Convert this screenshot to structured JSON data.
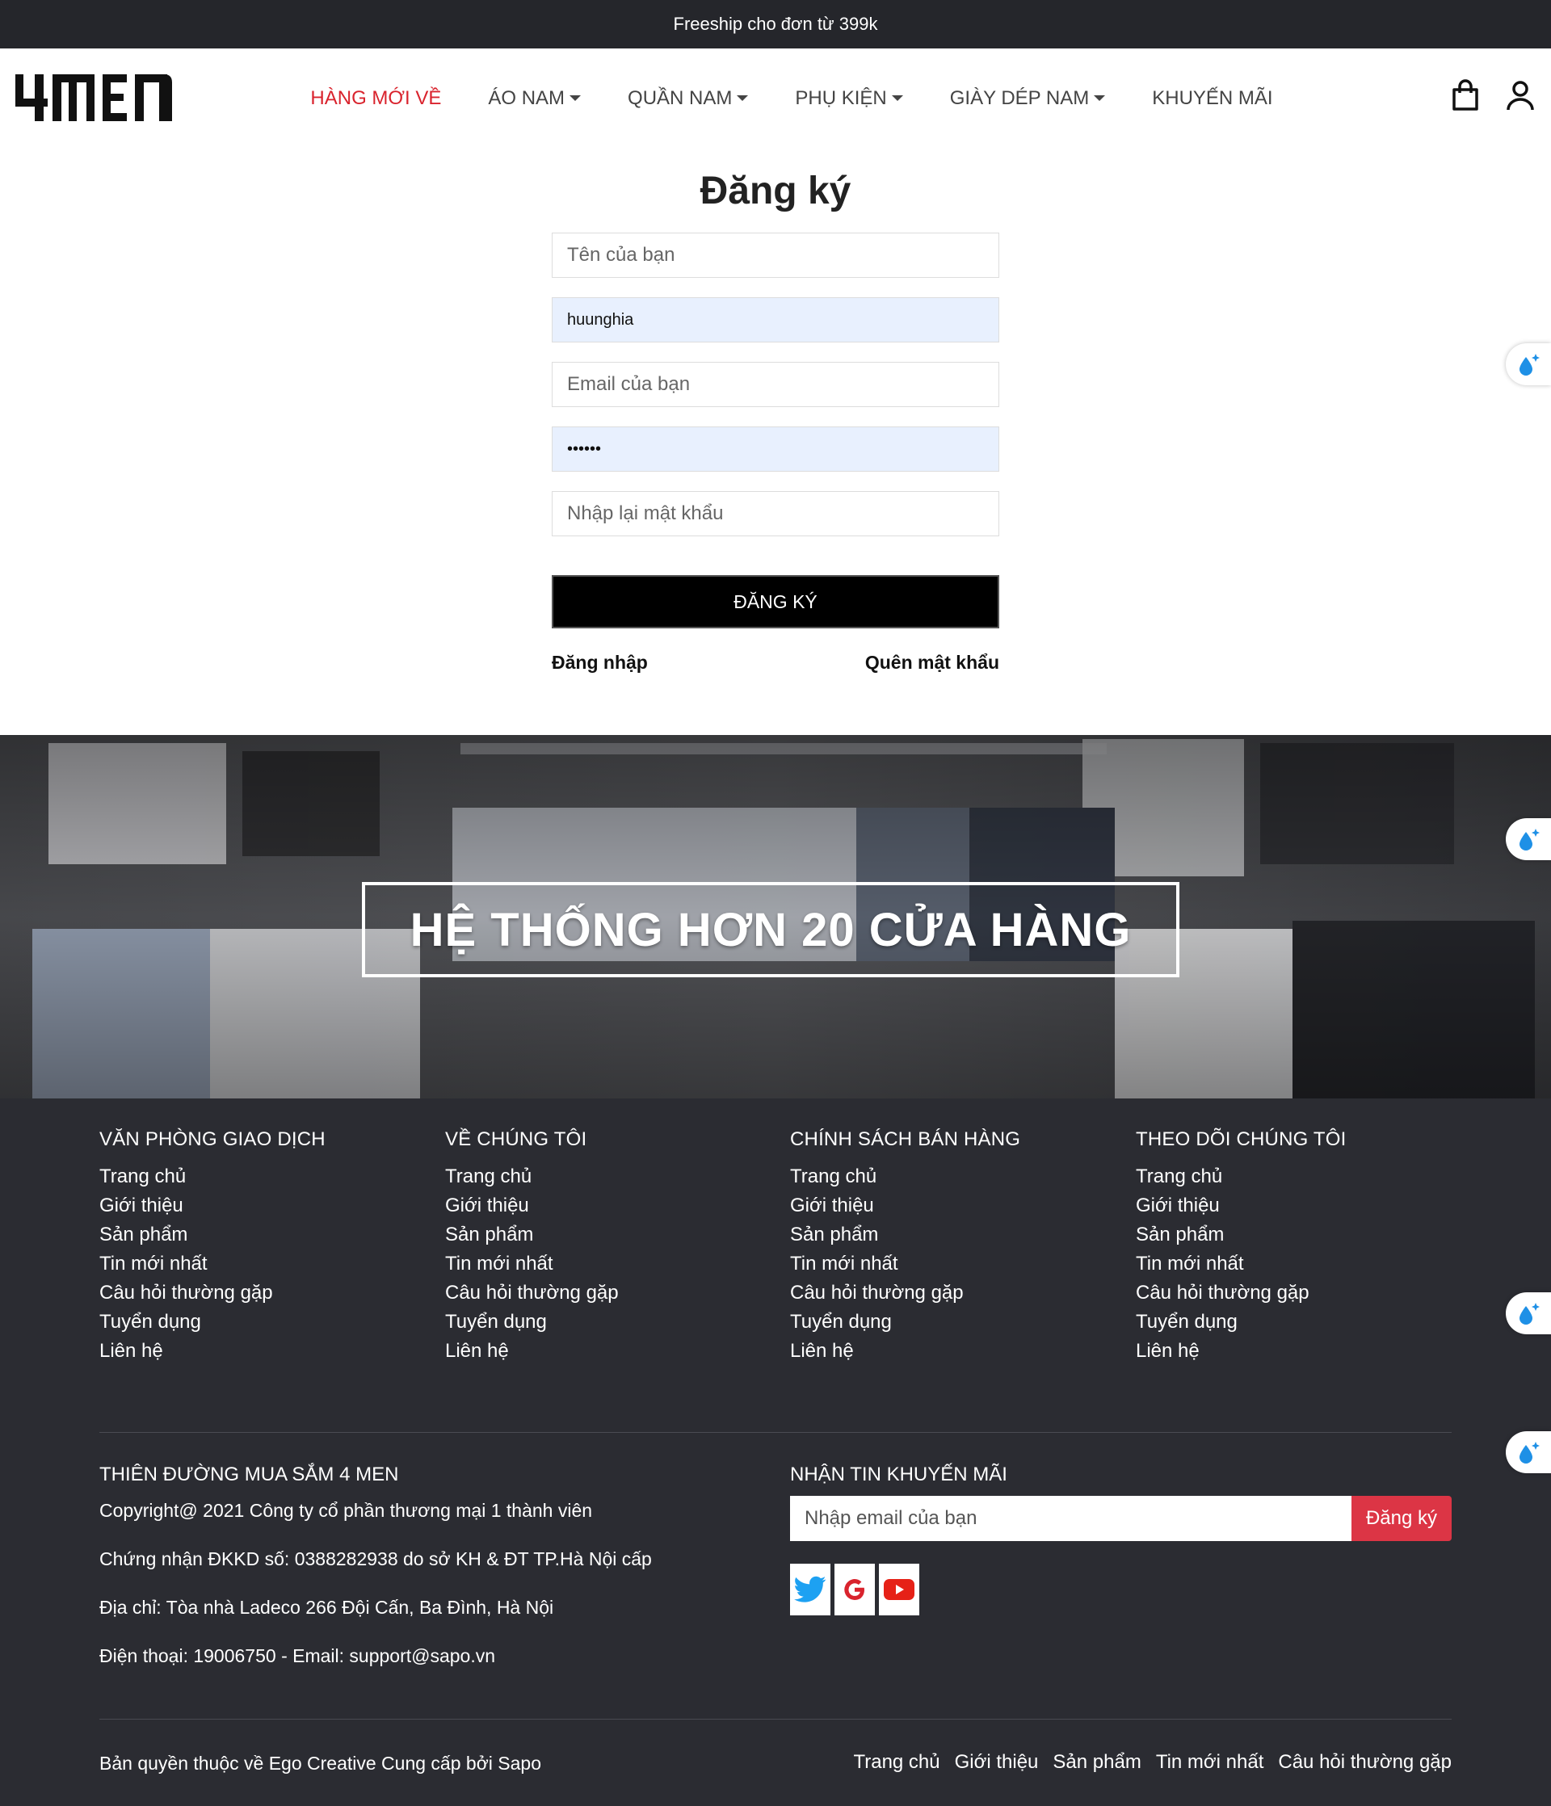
{
  "topbar": {
    "text": "Freeship cho đơn từ 399k"
  },
  "header": {
    "logo_text": "4MEN",
    "nav": [
      {
        "label": "HÀNG MỚI VỀ",
        "active": true,
        "dropdown": false
      },
      {
        "label": "ÁO NAM",
        "active": false,
        "dropdown": true
      },
      {
        "label": "QUẦN NAM",
        "active": false,
        "dropdown": true
      },
      {
        "label": "PHỤ KIỆN",
        "active": false,
        "dropdown": true
      },
      {
        "label": "GIÀY DÉP NAM",
        "active": false,
        "dropdown": true
      },
      {
        "label": "KHUYẾN MÃI",
        "active": false,
        "dropdown": false
      }
    ],
    "icons": [
      "cart-icon",
      "user-icon"
    ]
  },
  "register": {
    "title": "Đăng ký",
    "name_placeholder": "Tên của bạn",
    "username_value": "huunghia",
    "email_placeholder": "Email của bạn",
    "password_value": "••••••",
    "confirm_placeholder": "Nhập lại mật khẩu",
    "submit_label": "ĐĂNG KÝ",
    "login_link": "Đăng nhập",
    "forgot_link": "Quên mật khẩu"
  },
  "banner": {
    "text": "HỆ THỐNG HƠN 20 CỬA HÀNG"
  },
  "footer": {
    "columns": [
      {
        "title": "VĂN PHÒNG GIAO DỊCH",
        "links": [
          "Trang chủ",
          "Giới thiệu",
          "Sản phẩm",
          "Tin mới nhất",
          "Câu hỏi thường gặp",
          "Tuyển dụng",
          "Liên hệ"
        ]
      },
      {
        "title": "VỀ CHÚNG TÔI",
        "links": [
          "Trang chủ",
          "Giới thiệu",
          "Sản phẩm",
          "Tin mới nhất",
          "Câu hỏi thường gặp",
          "Tuyển dụng",
          "Liên hệ"
        ]
      },
      {
        "title": "CHÍNH SÁCH BÁN HÀNG",
        "links": [
          "Trang chủ",
          "Giới thiệu",
          "Sản phẩm",
          "Tin mới nhất",
          "Câu hỏi thường gặp",
          "Tuyển dụng",
          "Liên hệ"
        ]
      },
      {
        "title": "THEO DÕI CHÚNG TÔI",
        "links": [
          "Trang chủ",
          "Giới thiệu",
          "Sản phẩm",
          "Tin mới nhất",
          "Câu hỏi thường gặp",
          "Tuyển dụng",
          "Liên hệ"
        ]
      }
    ],
    "company_title": "THIÊN ĐƯỜNG MUA SẮM 4 MEN",
    "company_info": [
      "Copyright@ 2021 Công ty cổ phần thương mại 1 thành viên",
      "Chứng nhận ĐKKD số: 0388282938 do sở KH & ĐT TP.Hà Nội cấp",
      "Địa chỉ: Tòa nhà Ladeco 266 Đội Cấn, Ba Đình, Hà Nội",
      "Điện thoại: 19006750 - Email: support@sapo.vn"
    ],
    "newsletter_title": "NHẬN TIN KHUYẾN MÃI",
    "newsletter_placeholder": "Nhập email của bạn",
    "newsletter_button": "Đăng ký",
    "social": [
      "twitter-icon",
      "google-icon",
      "youtube-icon"
    ],
    "copyright": "Bản quyền thuộc về Ego Creative Cung cấp bởi Sapo",
    "bottom_links": [
      "Trang chủ",
      "Giới thiệu",
      "Sản phẩm",
      "Tin mới nhất",
      "Câu hỏi thường gặp"
    ]
  },
  "colors": {
    "accent": "#d9232d",
    "dark": "#25262b",
    "footer_bg": "#2b2c32",
    "autofill": "#e8f0fe",
    "button_red": "#dc3545"
  }
}
